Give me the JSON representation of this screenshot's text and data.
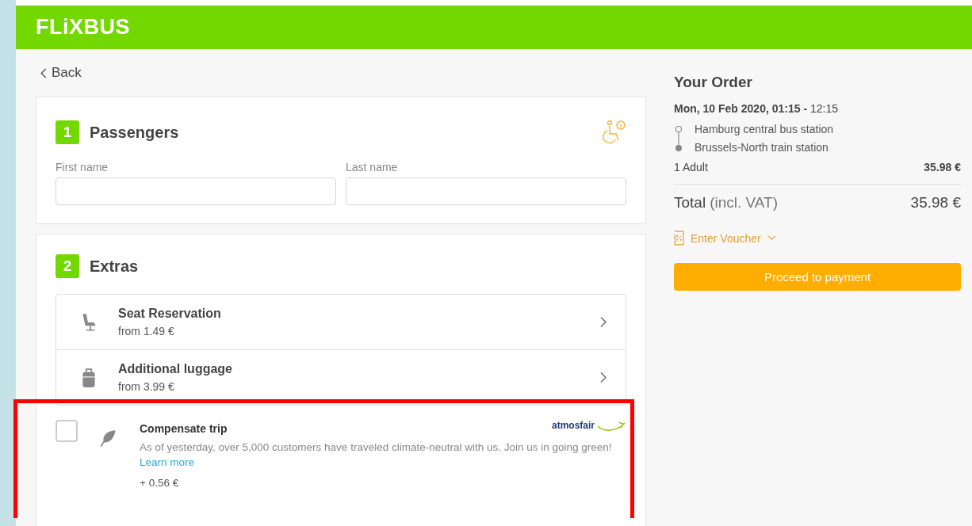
{
  "header": {
    "logo": "FLiXBUS"
  },
  "back": {
    "label": "Back"
  },
  "passengers": {
    "step": "1",
    "title": "Passengers",
    "fields": [
      {
        "label": "First name"
      },
      {
        "label": "Last name"
      }
    ]
  },
  "extras": {
    "step": "2",
    "title": "Extras",
    "items": [
      {
        "kind": "seat",
        "title": "Seat Reservation",
        "price": "from 1.49 €"
      },
      {
        "kind": "luggage",
        "title": "Additional luggage",
        "price": "from 3.99 €"
      }
    ],
    "compensation": {
      "checked": false,
      "highlighted": true,
      "title": "Compensate trip",
      "text": "As of yesterday, over 5,000 customers have traveled climate-neutral with us. Join us in going green!",
      "link": "Learn more",
      "price": "+ 0.56 €",
      "partner": "atmosfair"
    }
  },
  "order": {
    "title": "Your Order",
    "date": "**Mon, 10 Feb 2020, 01:15 -** 12:15",
    "stops": [
      {
        "name": "Hamburg central bus station"
      },
      {
        "name": "Brussels-North train station"
      }
    ],
    "passenger_label": "1 Adult",
    "passenger_price": "35.98 €",
    "total_label": "Total",
    "total_note": "(incl. VAT)",
    "total_price": "35.98 €",
    "voucher": "Enter Voucher",
    "button": "Proceed to payment"
  }
}
